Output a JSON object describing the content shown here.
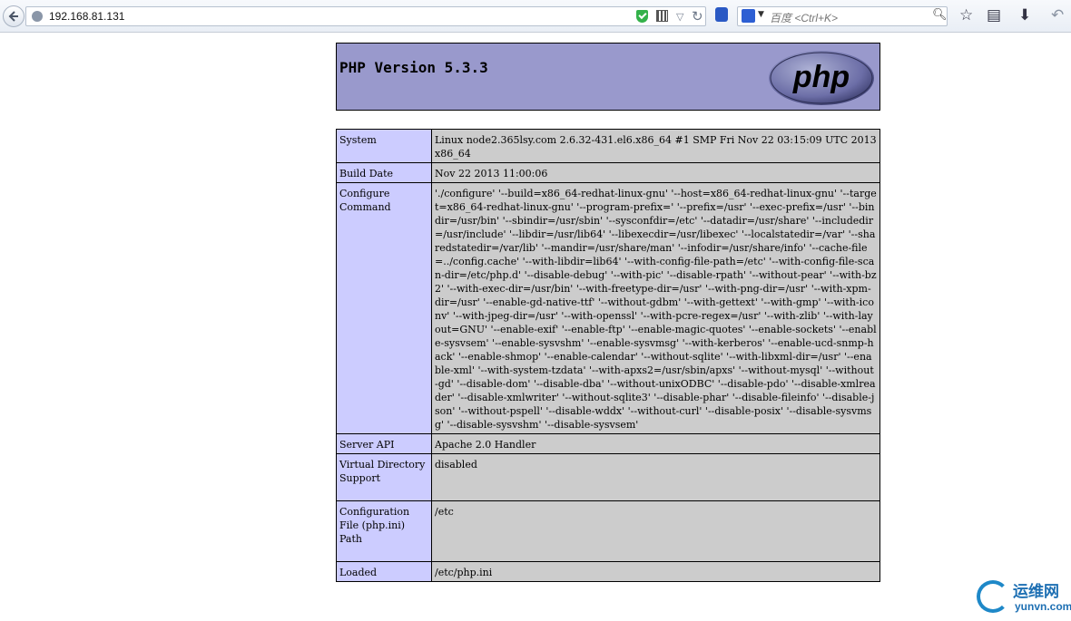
{
  "browser": {
    "url": "192.168.81.131",
    "search_placeholder": "百度 <Ctrl+K>",
    "icons": {
      "back": "back-arrow-icon",
      "site": "globe-icon",
      "secure": "shield-check-icon",
      "qr": "qr-code-icon",
      "dropdown": "chevron-down-icon",
      "reload": "reload-icon",
      "search": "magnifier-icon",
      "bookmark_star": "star-icon",
      "bookmarks_list": "bookmarks-list-icon",
      "download": "download-arrow-icon",
      "undo": "undo-icon"
    }
  },
  "phpinfo": {
    "title": "PHP Version 5.3.3",
    "logo_text": "php",
    "colors": {
      "header": "#9999cc",
      "key_cell": "#ccccff",
      "value_cell": "#cccccc"
    },
    "rows": [
      {
        "key": "System",
        "value": "Linux node2.365lsy.com 2.6.32-431.el6.x86_64 #1 SMP Fri Nov 22 03:15:09 UTC 2013 x86_64"
      },
      {
        "key": "Build Date",
        "value": "Nov 22 2013 11:00:06"
      },
      {
        "key": "Configure Command",
        "value": "'./configure' '--build=x86_64-redhat-linux-gnu' '--host=x86_64-redhat-linux-gnu' '--target=x86_64-redhat-linux-gnu' '--program-prefix=' '--prefix=/usr' '--exec-prefix=/usr' '--bindir=/usr/bin' '--sbindir=/usr/sbin' '--sysconfdir=/etc' '--datadir=/usr/share' '--includedir=/usr/include' '--libdir=/usr/lib64' '--libexecdir=/usr/libexec' '--localstatedir=/var' '--sharedstatedir=/var/lib' '--mandir=/usr/share/man' '--infodir=/usr/share/info' '--cache-file=../config.cache' '--with-libdir=lib64' '--with-config-file-path=/etc' '--with-config-file-scan-dir=/etc/php.d' '--disable-debug' '--with-pic' '--disable-rpath' '--without-pear' '--with-bz2' '--with-exec-dir=/usr/bin' '--with-freetype-dir=/usr' '--with-png-dir=/usr' '--with-xpm-dir=/usr' '--enable-gd-native-ttf' '--without-gdbm' '--with-gettext' '--with-gmp' '--with-iconv' '--with-jpeg-dir=/usr' '--with-openssl' '--with-pcre-regex=/usr' '--with-zlib' '--with-layout=GNU' '--enable-exif' '--enable-ftp' '--enable-magic-quotes' '--enable-sockets' '--enable-sysvsem' '--enable-sysvshm' '--enable-sysvmsg' '--with-kerberos' '--enable-ucd-snmp-hack' '--enable-shmop' '--enable-calendar' '--without-sqlite' '--with-libxml-dir=/usr' '--enable-xml' '--with-system-tzdata' '--with-apxs2=/usr/sbin/apxs' '--without-mysql' '--without-gd' '--disable-dom' '--disable-dba' '--without-unixODBC' '--disable-pdo' '--disable-xmlreader' '--disable-xmlwriter' '--without-sqlite3' '--disable-phar' '--disable-fileinfo' '--disable-json' '--without-pspell' '--disable-wddx' '--without-curl' '--disable-posix' '--disable-sysvmsg' '--disable-sysvshm' '--disable-sysvsem'"
      },
      {
        "key": "Server API",
        "value": "Apache 2.0 Handler"
      },
      {
        "key": "Virtual Directory Support",
        "value": "disabled"
      },
      {
        "key": "Configuration File (php.ini) Path",
        "value": "/etc"
      },
      {
        "key": "Loaded",
        "value": "/etc/php.ini"
      }
    ]
  },
  "watermark": {
    "name_cn": "运维网",
    "site": "yunvn.com"
  }
}
